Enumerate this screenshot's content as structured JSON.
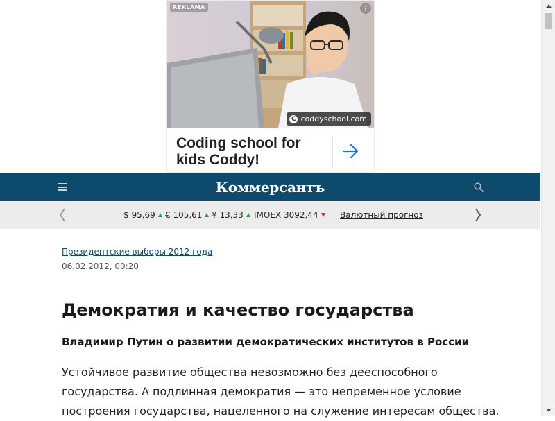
{
  "ad": {
    "badge": "REKLAMA",
    "domain": "coddyschool.com",
    "domain_icon": "C",
    "headline_line1": "Coding school for",
    "headline_line2": "kids Coddy!"
  },
  "header": {
    "logo": "Коммерсантъ",
    "color": "#0d4a6b"
  },
  "rates": {
    "items": [
      {
        "label": "$ 95,69",
        "trend": "up"
      },
      {
        "label": "€ 105,61",
        "trend": "up"
      },
      {
        "label": "¥ 13,33",
        "trend": "up"
      },
      {
        "label": "IMOEX 3092,44",
        "trend": "down"
      }
    ],
    "forecast_link": "Валютный прогноз"
  },
  "article": {
    "rubric": "Президентские выборы 2012 года",
    "date": "06.02.2012, 00:20",
    "title": "Демократия и качество государства",
    "subtitle": "Владимир Путин о развитии демократических институтов в России",
    "body_lines": [
      "Устойчивое развитие общества невозможно без дееспособного",
      "государства. А подлинная демократия — это непременное условие",
      "построения государства, нацеленного на служение интересам общества."
    ]
  },
  "icons": {
    "menu": "hamburger-icon",
    "search": "search-icon",
    "prev": "chevron-left-icon",
    "next": "chevron-right-icon",
    "ad_arrow": "arrow-right-icon"
  },
  "colors": {
    "up": "#2e9e3e",
    "down": "#dd2222",
    "link": "#0d4a6b"
  }
}
